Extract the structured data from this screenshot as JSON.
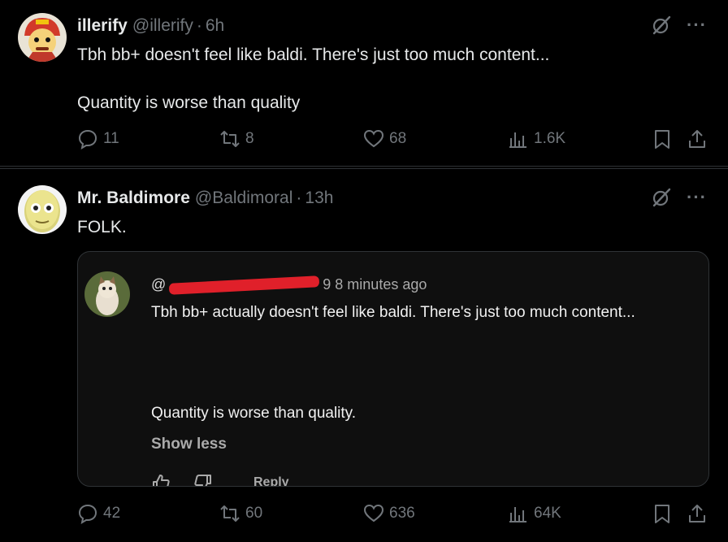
{
  "posts": [
    {
      "name": "illerify",
      "handle": "@illerify",
      "separator": "·",
      "time": "6h",
      "more": "···",
      "text_lines": [
        "Tbh bb+ doesn't feel like baldi. There's just too much content...",
        "Quantity is worse than quality"
      ],
      "stats": {
        "replies": "11",
        "reposts": "8",
        "likes": "68",
        "views": "1.6K"
      }
    },
    {
      "name": "Mr. Baldimore",
      "handle": "@Baldimoral",
      "separator": "·",
      "time": "13h",
      "more": "···",
      "text_lines": [
        "FOLK."
      ],
      "stats": {
        "replies": "42",
        "reposts": "60",
        "likes": "636",
        "views": "64K"
      }
    }
  ],
  "embed": {
    "user_prefix": "@",
    "time": "9 8 minutes ago",
    "text_line1": "Tbh bb+ actually doesn't feel like baldi. There's just too much content...",
    "text_line2": "Quantity is worse than quality.",
    "show_less": "Show less",
    "reply_label": "Reply",
    "redaction_color": "#e0202a"
  },
  "colors": {
    "background": "#000000",
    "text": "#e7e9ea",
    "muted": "#71767b",
    "divider": "#2f3336"
  }
}
